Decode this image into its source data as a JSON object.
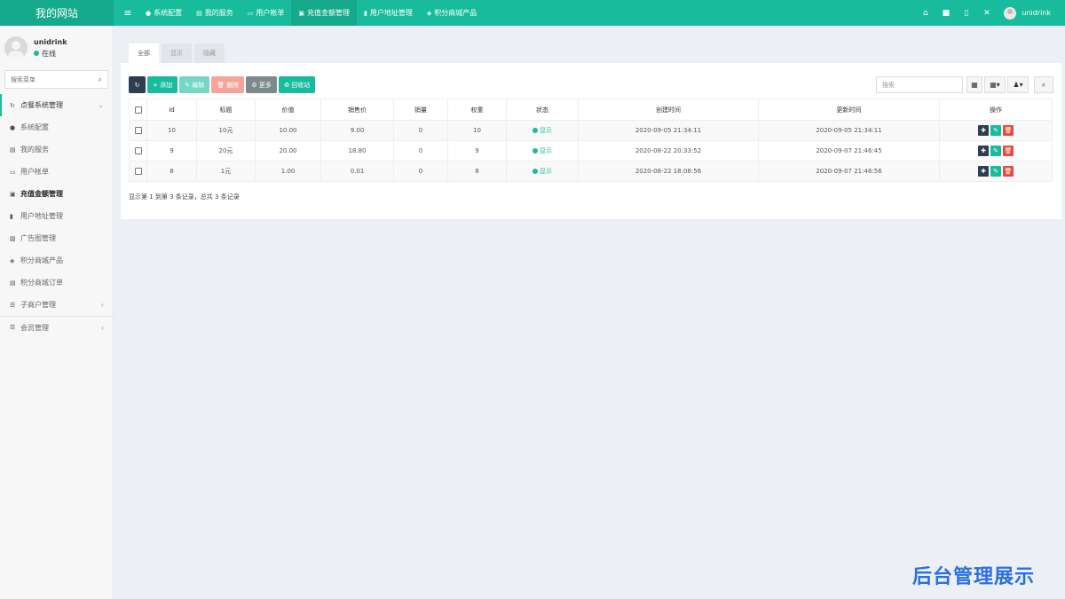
{
  "header": {
    "logo": "我的网站",
    "hamburger": "≡",
    "nav": [
      {
        "icon": "●",
        "label": "系统配置"
      },
      {
        "icon": "▤",
        "label": "我的服务"
      },
      {
        "icon": "▭",
        "label": "用户帐单"
      },
      {
        "icon": "▣",
        "label": "充值金额管理"
      },
      {
        "icon": "▮",
        "label": "用户地址管理"
      },
      {
        "icon": "◈",
        "label": "积分商城产品"
      }
    ],
    "right_icons": [
      "⌂",
      "■",
      "▯",
      "✕"
    ],
    "user": "unidrink"
  },
  "sidebar": {
    "user_name": "unidrink",
    "user_status": "在线",
    "search_placeholder": "搜索菜单",
    "search_icon": "⌕",
    "items": [
      {
        "icon": "↻",
        "label": "点餐系统管理",
        "arrow": "⌄"
      },
      {
        "icon": "●",
        "label": "系统配置",
        "arrow": ""
      },
      {
        "icon": "▤",
        "label": "我的服务",
        "arrow": ""
      },
      {
        "icon": "▭",
        "label": "用户帐单",
        "arrow": ""
      },
      {
        "icon": "▣",
        "label": "充值金额管理",
        "arrow": ""
      },
      {
        "icon": "▮",
        "label": "用户地址管理",
        "arrow": ""
      },
      {
        "icon": "▨",
        "label": "广告图管理",
        "arrow": ""
      },
      {
        "icon": "◈",
        "label": "积分商城产品",
        "arrow": ""
      },
      {
        "icon": "▤",
        "label": "积分商城订单",
        "arrow": ""
      },
      {
        "icon": "☰",
        "label": "子商户管理",
        "arrow": "‹"
      },
      {
        "icon": "☰",
        "label": "会员管理",
        "arrow": "‹"
      }
    ]
  },
  "tabs": [
    "全部",
    "显示",
    "隐藏"
  ],
  "toolbar": {
    "refresh": "↻",
    "add": "+ 添加",
    "edit": "✎ 编辑",
    "delete": "🗑 删除",
    "more": "⚙ 更多",
    "recycle": "♻ 回收站"
  },
  "search_placeholder": "搜索",
  "tool_buttons": [
    "▦",
    "▦▾",
    "♟▾",
    "⌕"
  ],
  "table": {
    "columns": [
      "Id",
      "标题",
      "价值",
      "销售价",
      "销量",
      "权重",
      "状态",
      "创建时间",
      "更新时间",
      "操作"
    ],
    "rows": [
      {
        "id": "10",
        "title": "10元",
        "value": "10.00",
        "price": "9.00",
        "sales": "0",
        "weight": "10",
        "status": "显示",
        "created": "2020-09-05 21:34:11",
        "updated": "2020-09-05 21:34:11"
      },
      {
        "id": "9",
        "title": "20元",
        "value": "20.00",
        "price": "18.80",
        "sales": "0",
        "weight": "9",
        "status": "显示",
        "created": "2020-08-22 20:33:52",
        "updated": "2020-09-07 21:46:45"
      },
      {
        "id": "8",
        "title": "1元",
        "value": "1.00",
        "price": "0.01",
        "sales": "0",
        "weight": "8",
        "status": "显示",
        "created": "2020-08-22 18:06:56",
        "updated": "2020-09-07 21:46:56"
      }
    ],
    "op_icons": [
      "✚",
      "✎",
      "🗑"
    ]
  },
  "pager_text": "显示第 1 到第 3 条记录，总共 3 条记录",
  "watermark": "后台管理展示"
}
